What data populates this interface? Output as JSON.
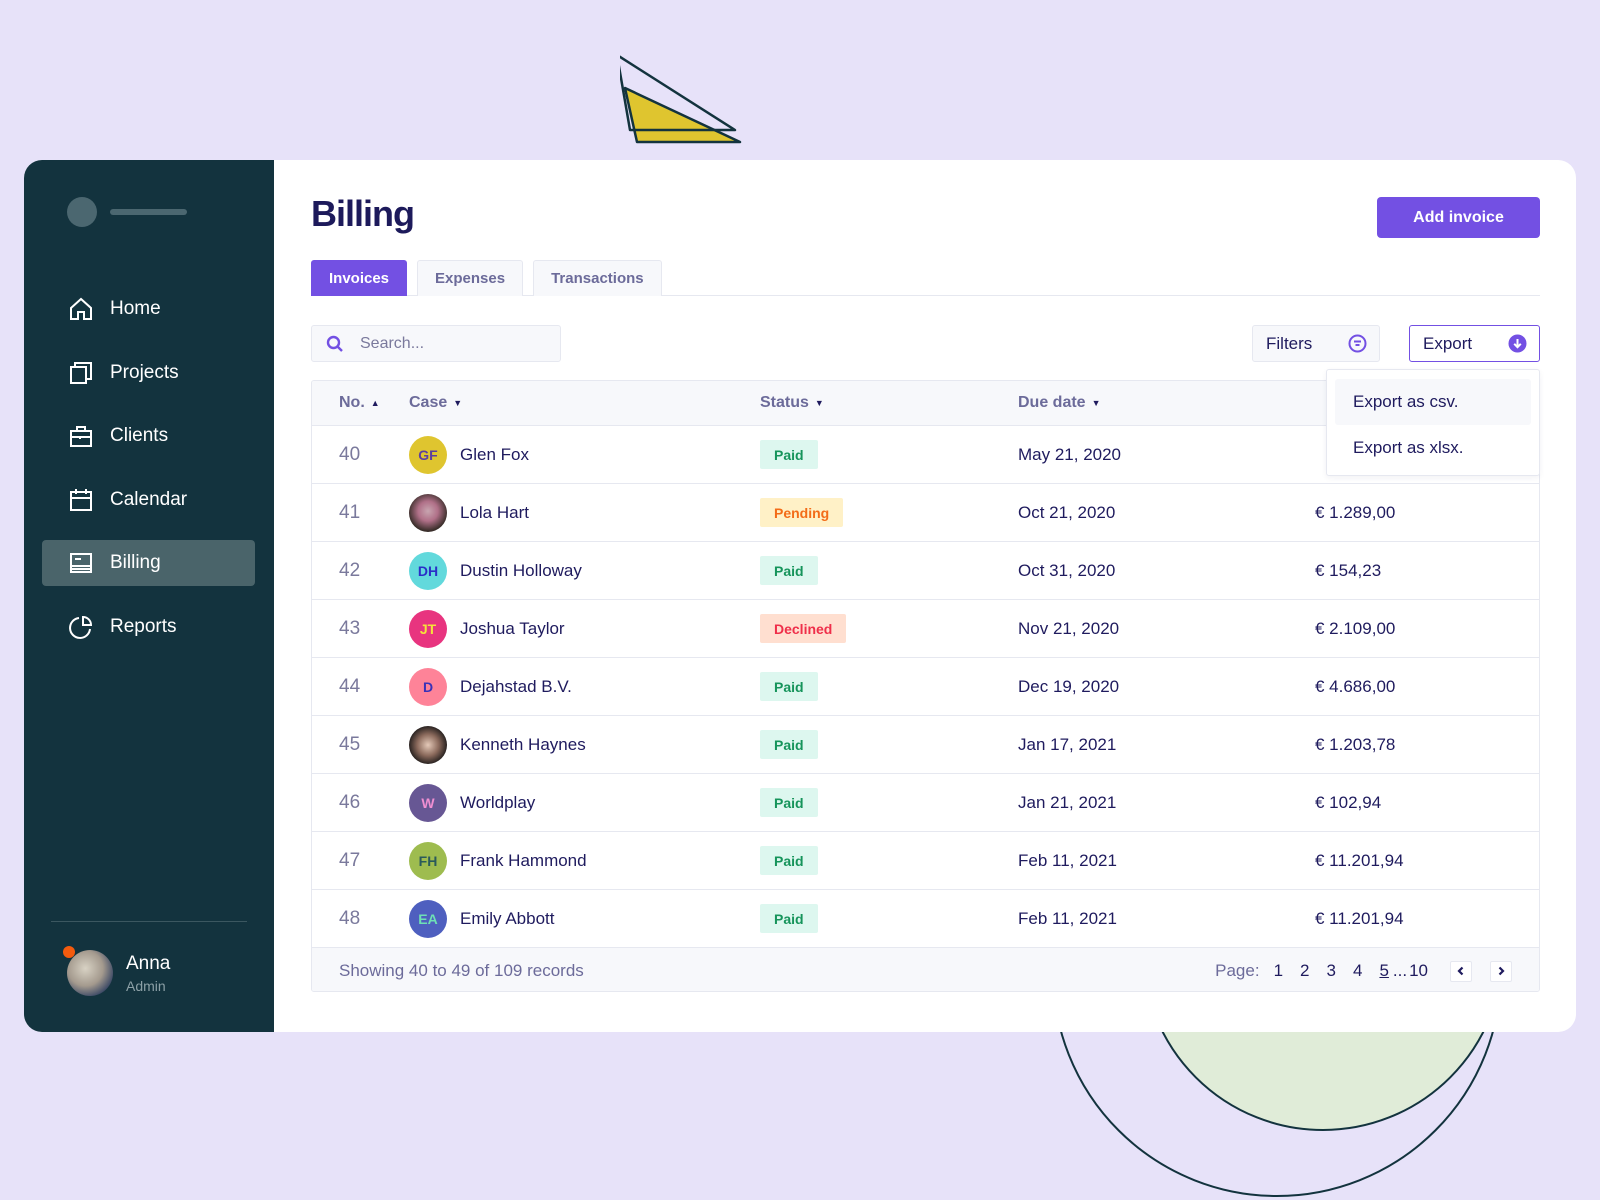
{
  "app": {
    "page_title": "Billing",
    "add_button": "Add invoice",
    "accent_color": "#7350e3"
  },
  "sidebar": {
    "items": [
      {
        "label": "Home",
        "icon": "home-icon",
        "active": false
      },
      {
        "label": "Projects",
        "icon": "projects-icon",
        "active": false
      },
      {
        "label": "Clients",
        "icon": "briefcase-icon",
        "active": false
      },
      {
        "label": "Calendar",
        "icon": "calendar-icon",
        "active": false
      },
      {
        "label": "Billing",
        "icon": "billing-icon",
        "active": true
      },
      {
        "label": "Reports",
        "icon": "pie-chart-icon",
        "active": false
      }
    ],
    "user": {
      "name": "Anna",
      "role": "Admin",
      "status_color": "#f45b0e"
    }
  },
  "tabs": [
    {
      "label": "Invoices",
      "active": true
    },
    {
      "label": "Expenses",
      "active": false
    },
    {
      "label": "Transactions",
      "active": false
    }
  ],
  "toolbar": {
    "search_placeholder": "Search...",
    "search_value": "",
    "filters_label": "Filters",
    "export_label": "Export"
  },
  "export_menu": {
    "items": [
      "Export as csv.",
      "Export as xlsx."
    ]
  },
  "table": {
    "columns": [
      {
        "label": "No.",
        "sort": "asc"
      },
      {
        "label": "Case",
        "sort": "desc"
      },
      {
        "label": "Status",
        "sort": "desc"
      },
      {
        "label": "Due date",
        "sort": "desc"
      }
    ],
    "rows": [
      {
        "no": "40",
        "initials": "GF",
        "avatar_bg": "#dfc52f",
        "avatar_fg": "#5c3ea0",
        "photo": "",
        "name": "Glen Fox",
        "status": "Paid",
        "due": "May 21, 2020",
        "amount": ""
      },
      {
        "no": "41",
        "initials": "",
        "avatar_bg": "",
        "avatar_fg": "",
        "photo": "photo1",
        "name": "Lola Hart",
        "status": "Pending",
        "due": "Oct 21, 2020",
        "amount": "€ 1.289,00"
      },
      {
        "no": "42",
        "initials": "DH",
        "avatar_bg": "#62d9dc",
        "avatar_fg": "#2a2fc8",
        "photo": "",
        "name": "Dustin Holloway",
        "status": "Paid",
        "due": "Oct 31, 2020",
        "amount": "€ 154,23"
      },
      {
        "no": "43",
        "initials": "JT",
        "avatar_bg": "#e8347f",
        "avatar_fg": "#f5e23a",
        "photo": "",
        "name": "Joshua Taylor",
        "status": "Declined",
        "due": "Nov 21, 2020",
        "amount": "€ 2.109,00"
      },
      {
        "no": "44",
        "initials": "D",
        "avatar_bg": "#fe8398",
        "avatar_fg": "#3a32b8",
        "photo": "",
        "name": "Dejahstad B.V.",
        "status": "Paid",
        "due": "Dec 19, 2020",
        "amount": "€ 4.686,00"
      },
      {
        "no": "45",
        "initials": "",
        "avatar_bg": "",
        "avatar_fg": "",
        "photo": "photo2",
        "name": "Kenneth Haynes",
        "status": "Paid",
        "due": "Jan 17, 2021",
        "amount": "€ 1.203,78"
      },
      {
        "no": "46",
        "initials": "W",
        "avatar_bg": "#675794",
        "avatar_fg": "#f08fd2",
        "photo": "",
        "name": "Worldplay",
        "status": "Paid",
        "due": "Jan 21, 2021",
        "amount": "€ 102,94"
      },
      {
        "no": "47",
        "initials": "FH",
        "avatar_bg": "#9ebc4f",
        "avatar_fg": "#2a5a5a",
        "photo": "",
        "name": "Frank Hammond",
        "status": "Paid",
        "due": "Feb 11, 2021",
        "amount": "€ 11.201,94"
      },
      {
        "no": "48",
        "initials": "EA",
        "avatar_bg": "#4e5fbf",
        "avatar_fg": "#6ee0b5",
        "photo": "",
        "name": "Emily Abbott",
        "status": "Paid",
        "due": "Feb 11, 2021",
        "amount": "€ 11.201,94"
      }
    ]
  },
  "footer": {
    "showing": "Showing 40 to 49 of 109 records",
    "page_label": "Page:",
    "pages": [
      "1",
      "2",
      "3",
      "4",
      "5"
    ],
    "current_page": "5",
    "ellipsis": "...",
    "last_page": "10"
  }
}
